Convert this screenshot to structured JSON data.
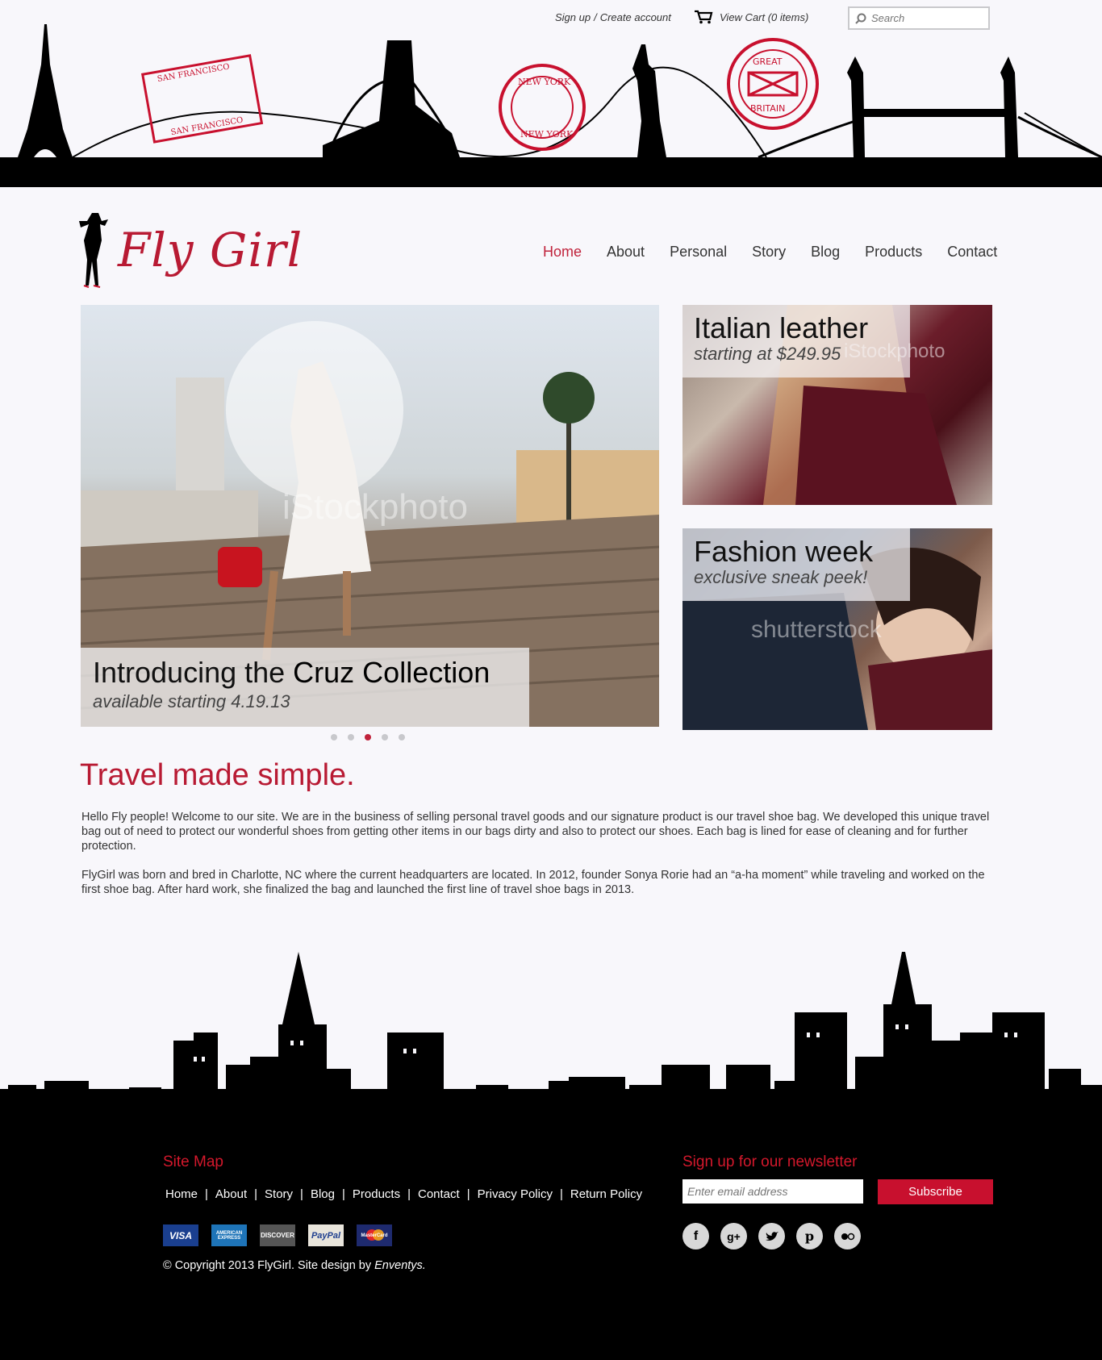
{
  "header": {
    "signup": "Sign up",
    "divider": "/",
    "create_account": "Create account",
    "cart_label": "View Cart (0 items)",
    "search_placeholder": "Search",
    "stamps": {
      "sf_top": "SAN FRANCISCO",
      "sf_bottom": "SAN FRANCISCO",
      "ny_top": "NEW YORK",
      "ny_bottom": "NEW YORK",
      "gb_top": "GREAT",
      "gb_bottom": "BRITAIN"
    }
  },
  "logo": {
    "text": "Fly Girl"
  },
  "nav": {
    "items": [
      {
        "label": "Home",
        "active": true
      },
      {
        "label": "About"
      },
      {
        "label": "Personal"
      },
      {
        "label": "Story"
      },
      {
        "label": "Blog"
      },
      {
        "label": "Products"
      },
      {
        "label": "Contact"
      }
    ]
  },
  "hero": {
    "title_prefix": "Introducing the ",
    "title_emphasis": "Cruz Collection",
    "subtitle": "available starting 4.19.13",
    "watermark": "iStockphoto",
    "slides": 5,
    "active_slide": 3
  },
  "promos": [
    {
      "title": "Italian leather",
      "subtitle": "starting at $249.95",
      "watermark": "iStockphoto"
    },
    {
      "title": "Fashion week",
      "subtitle": "exclusive sneak peek!",
      "watermark": "shutterstock"
    }
  ],
  "main": {
    "title": "Travel made simple.",
    "paragraph1": "Hello Fly people!  Welcome to our site.  We are in the business of selling personal travel goods and our signature product is our travel shoe bag.  We developed this unique travel bag out of need to protect our wonderful shoes from getting other items in our bags dirty and also to protect our shoes.  Each bag is lined for ease of cleaning and for further protection.",
    "paragraph2": "FlyGirl was born and bred in Charlotte, NC where the current headquarters are located.  In 2012, founder Sonya Rorie had an “a-ha moment” while traveling and worked on the first shoe bag.  After hard work, she finalized the bag and launched the first line of travel shoe bags in 2013."
  },
  "footer": {
    "sitemap_title": "Site Map",
    "links": [
      "Home",
      "About",
      "Story",
      "Blog",
      "Products",
      "Contact",
      "Privacy Policy",
      "Return Policy"
    ],
    "newsletter_title": "Sign up for our newsletter",
    "email_placeholder": "Enter email address",
    "subscribe_label": "Subscribe",
    "payment_cards": [
      {
        "name": "VISA",
        "color": "#1a3f8f"
      },
      {
        "name": "AMERICAN EXPRESS",
        "color": "#1e74b8"
      },
      {
        "name": "DISCOVER",
        "color": "#555555"
      },
      {
        "name": "PayPal",
        "color": "#e9e5dc"
      },
      {
        "name": "MasterCard",
        "color": "#1e2a6e"
      }
    ],
    "socials": [
      "f",
      "g+",
      "t",
      "p",
      "flickr"
    ],
    "copyright_prefix": "© Copyright 2013 FlyGirl. Site design by ",
    "copyright_designer": "Enventys."
  },
  "colors": {
    "accent": "#c0223b",
    "footer_bg": "#000000",
    "page_bg": "#f8f7fb"
  }
}
